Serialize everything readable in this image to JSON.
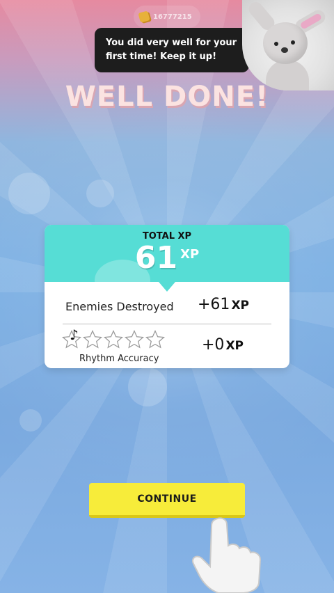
{
  "currency": {
    "icon": "coin-icon",
    "amount": "16777215"
  },
  "dialog": {
    "text": "You did very well for your first time! Keep it up!"
  },
  "avatar": {
    "icon": "bunny-avatar"
  },
  "heading": "WELL DONE!",
  "total_xp": {
    "label": "TOTAL XP",
    "value": "61",
    "unit": "XP"
  },
  "rows": {
    "enemies": {
      "label": "Enemies Destroyed",
      "value": "+61",
      "unit": "XP"
    },
    "rhythm": {
      "label": "Rhythm Accuracy",
      "value": "+0",
      "unit": "XP",
      "stars_filled": 0,
      "stars_total": 5,
      "icon": "music-note-icon"
    }
  },
  "continue_button": {
    "label": "CONTINUE"
  },
  "tutorial_hand": {
    "icon": "pointing-hand-icon"
  },
  "colors": {
    "accent": "#56ddd5",
    "button": "#f7ec3a",
    "heading": "#fbe3e1"
  }
}
